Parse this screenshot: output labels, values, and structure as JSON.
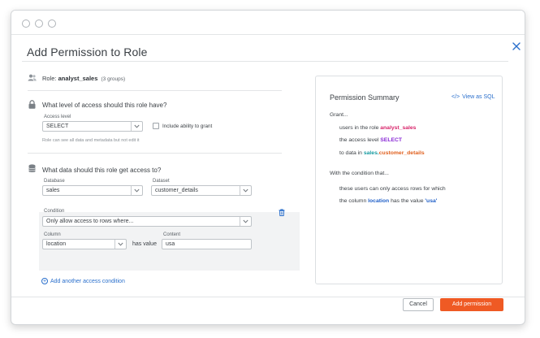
{
  "modal": {
    "title": "Add Permission to Role"
  },
  "role": {
    "prefix": "Role:",
    "name": "analyst_sales",
    "groups": "(3 groups)"
  },
  "access": {
    "question": "What level of access should this role have?",
    "level_label": "Access level",
    "level_value": "SELECT",
    "grant_checkbox_label": "Include ability to grant",
    "grant_checked": false,
    "hint": "Role can see all data and metadata but not edit it"
  },
  "data_access": {
    "question": "What data should this role get access to?",
    "database_label": "Database",
    "database_value": "sales",
    "dataset_label": "Dataset",
    "dataset_value": "customer_details",
    "condition_label": "Condition",
    "condition_value": "Only allow access to rows where...",
    "column_label": "Column",
    "column_value": "location",
    "has_value_text": "has value",
    "content_label": "Content",
    "content_value": "usa",
    "add_condition_label": "Add another access condition"
  },
  "summary": {
    "title": "Permission Summary",
    "view_sql_label": "View as SQL",
    "grant_label": "Grant...",
    "line1_prefix": "users in the role",
    "line1_value": "analyst_sales",
    "line2_prefix": "the access level",
    "line2_value": "SELECT",
    "line3_prefix": "to data in",
    "line3_db": "sales",
    "line3_sep": ".",
    "line3_table": "customer_details",
    "condition_intro": "With the condition that...",
    "line4": "these users can only access rows for which",
    "line5_prefix": "the column",
    "line5_column": "location",
    "line5_mid": "has the value",
    "line5_value": "'usa'"
  },
  "footer": {
    "cancel_label": "Cancel",
    "submit_label": "Add permission"
  },
  "colors": {
    "primary": "#ef5a24",
    "link": "#2a6fcc",
    "role_highlight": "#d8246a",
    "access_highlight": "#8a2bd6",
    "db_highlight": "#159aa0",
    "table_highlight": "#e0601e",
    "column_highlight": "#1f5fc8"
  }
}
